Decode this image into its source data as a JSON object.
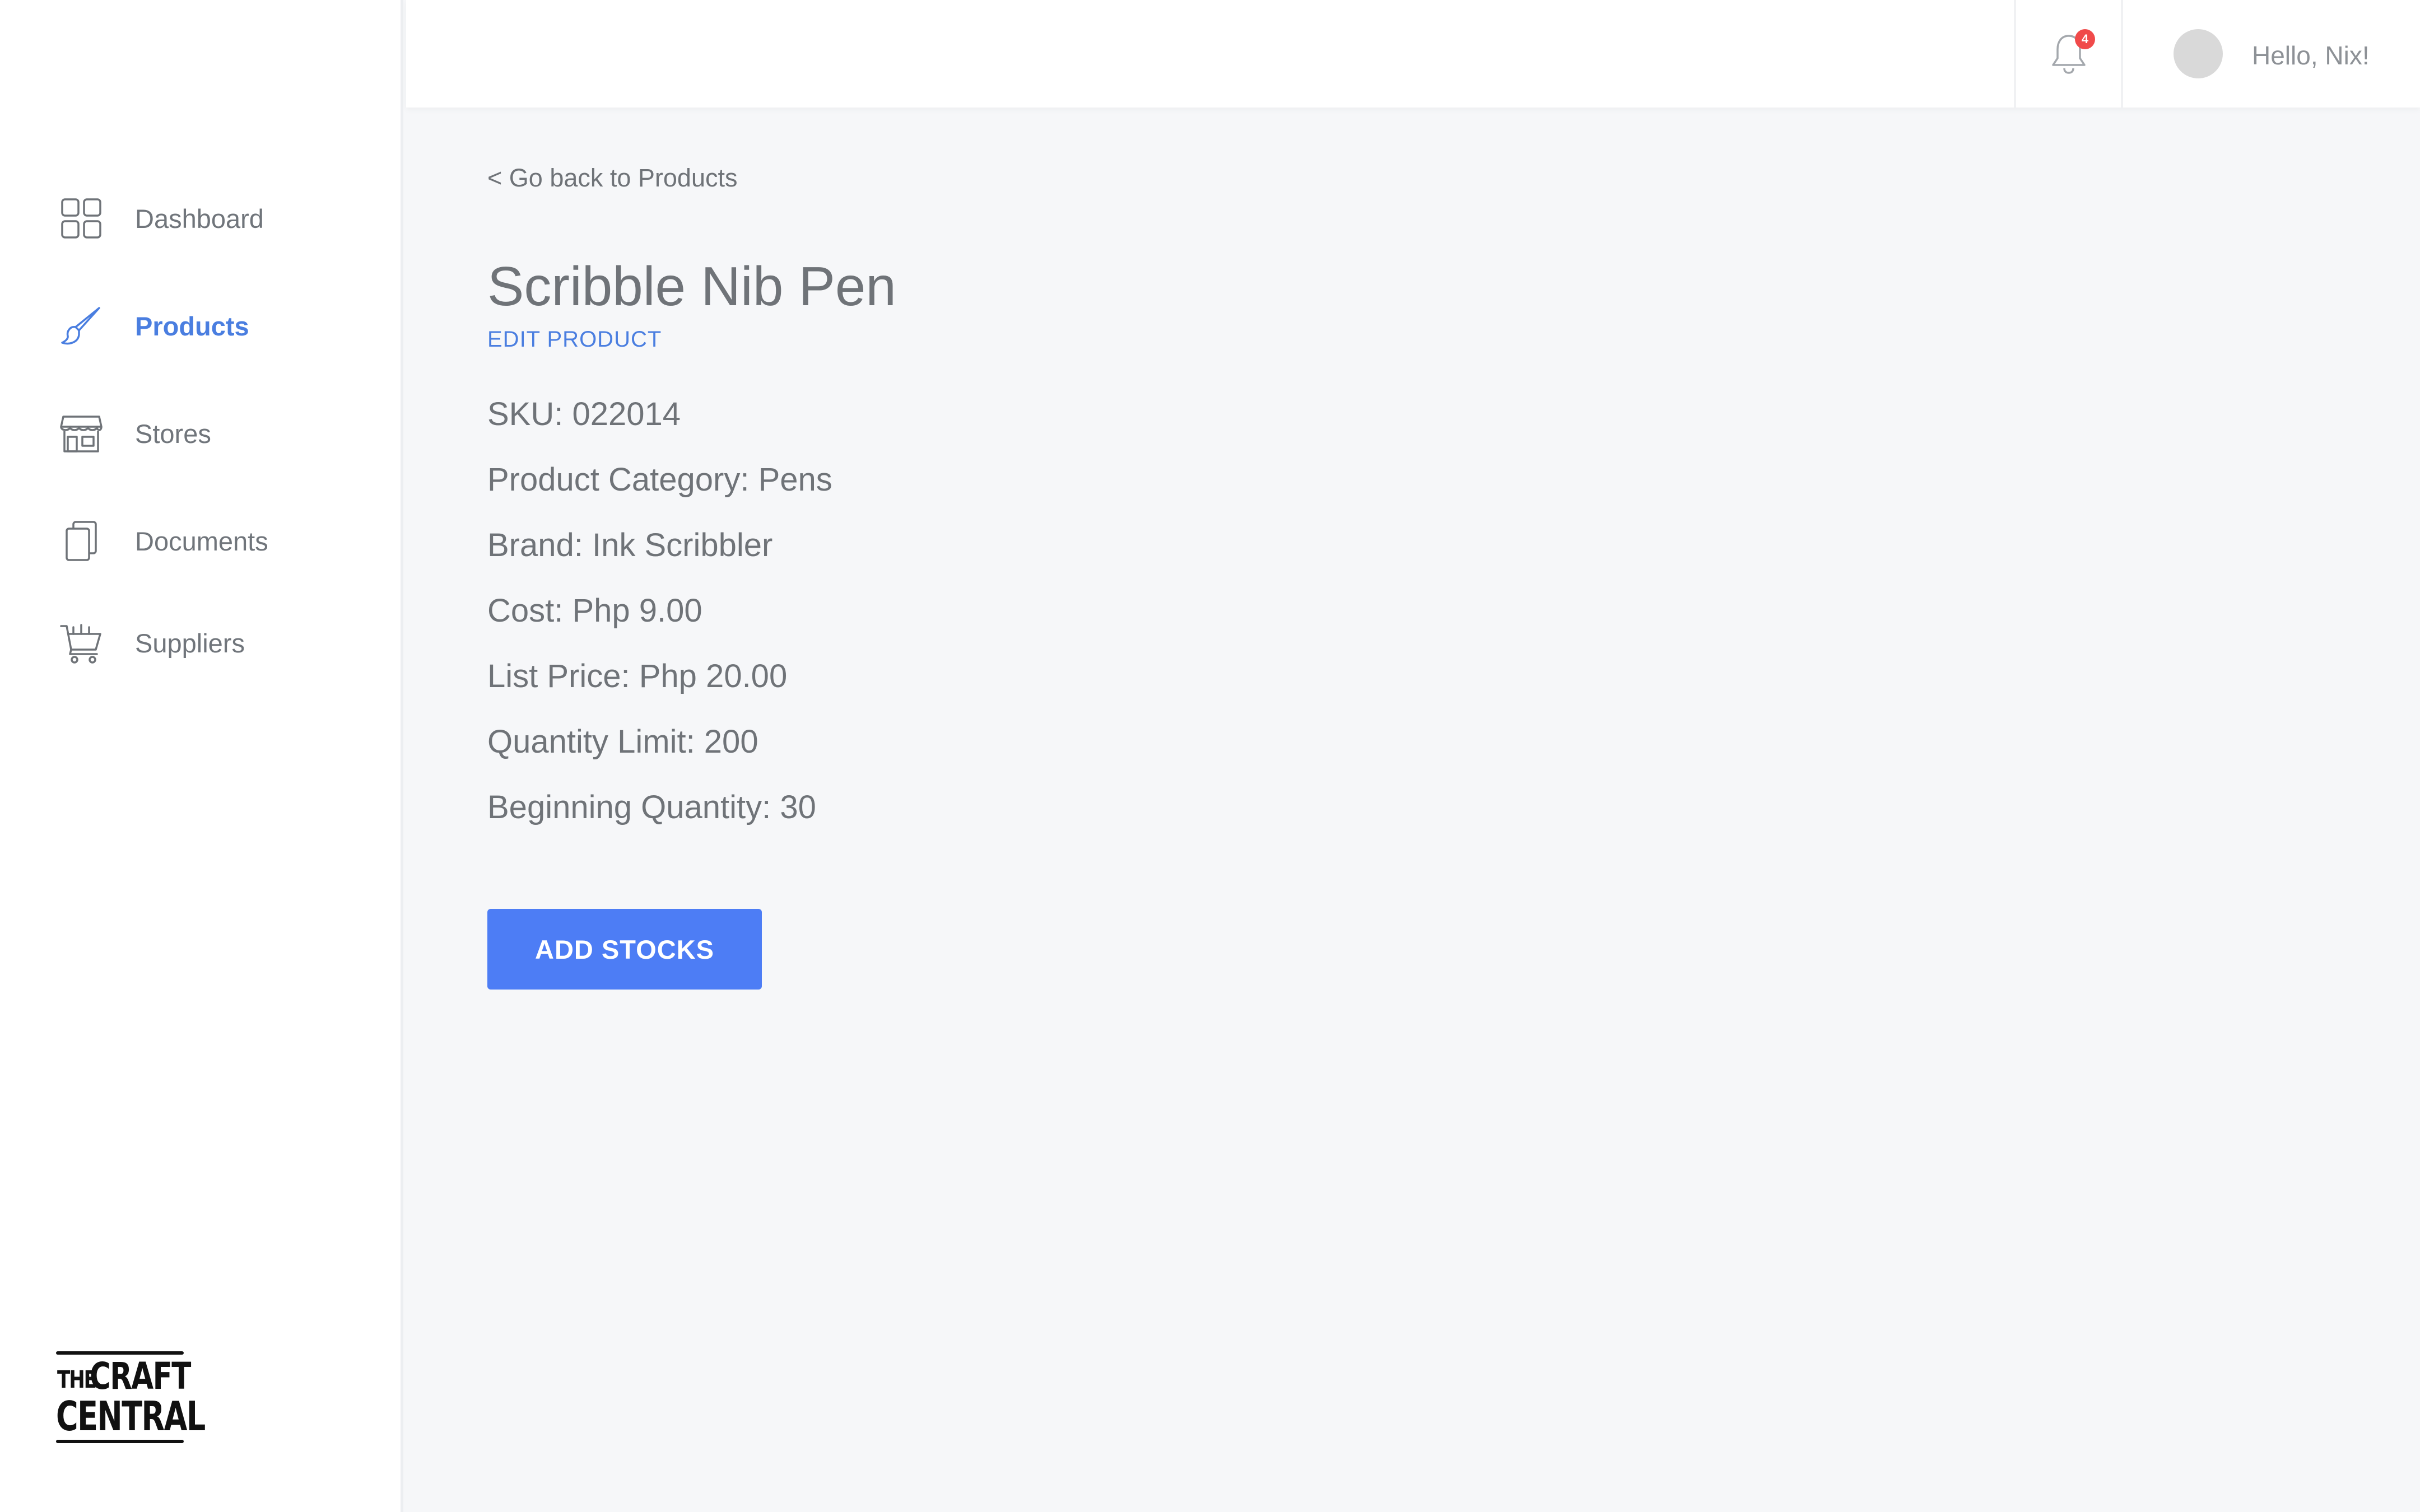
{
  "sidebar": {
    "items": [
      {
        "label": "Dashboard",
        "icon": "dashboard-grid-icon",
        "active": false
      },
      {
        "label": "Products",
        "icon": "brush-icon",
        "active": true
      },
      {
        "label": "Stores",
        "icon": "storefront-icon",
        "active": false
      },
      {
        "label": "Documents",
        "icon": "documents-icon",
        "active": false
      },
      {
        "label": "Suppliers",
        "icon": "cart-icon",
        "active": false
      }
    ],
    "logo": {
      "line1": "THE",
      "line2": "CRAFT",
      "line3": "CENTRAL"
    }
  },
  "header": {
    "notification_count": "4",
    "greeting": "Hello, Nix!"
  },
  "main": {
    "back_link": "< Go back to Products",
    "product_title": "Scribble Nib Pen",
    "edit_link": "EDIT PRODUCT",
    "details": [
      "SKU: 022014",
      "Product Category: Pens",
      "Brand: Ink Scribbler",
      "Cost: Php 9.00",
      "List Price: Php 20.00",
      "Quantity Limit: 200",
      "Beginning Quantity: 30"
    ],
    "add_button": "ADD STOCKS"
  },
  "colors": {
    "accent": "#4a7ee0",
    "button": "#4d7df5",
    "badge": "#f04a4a",
    "background": "#f6f7f9"
  }
}
